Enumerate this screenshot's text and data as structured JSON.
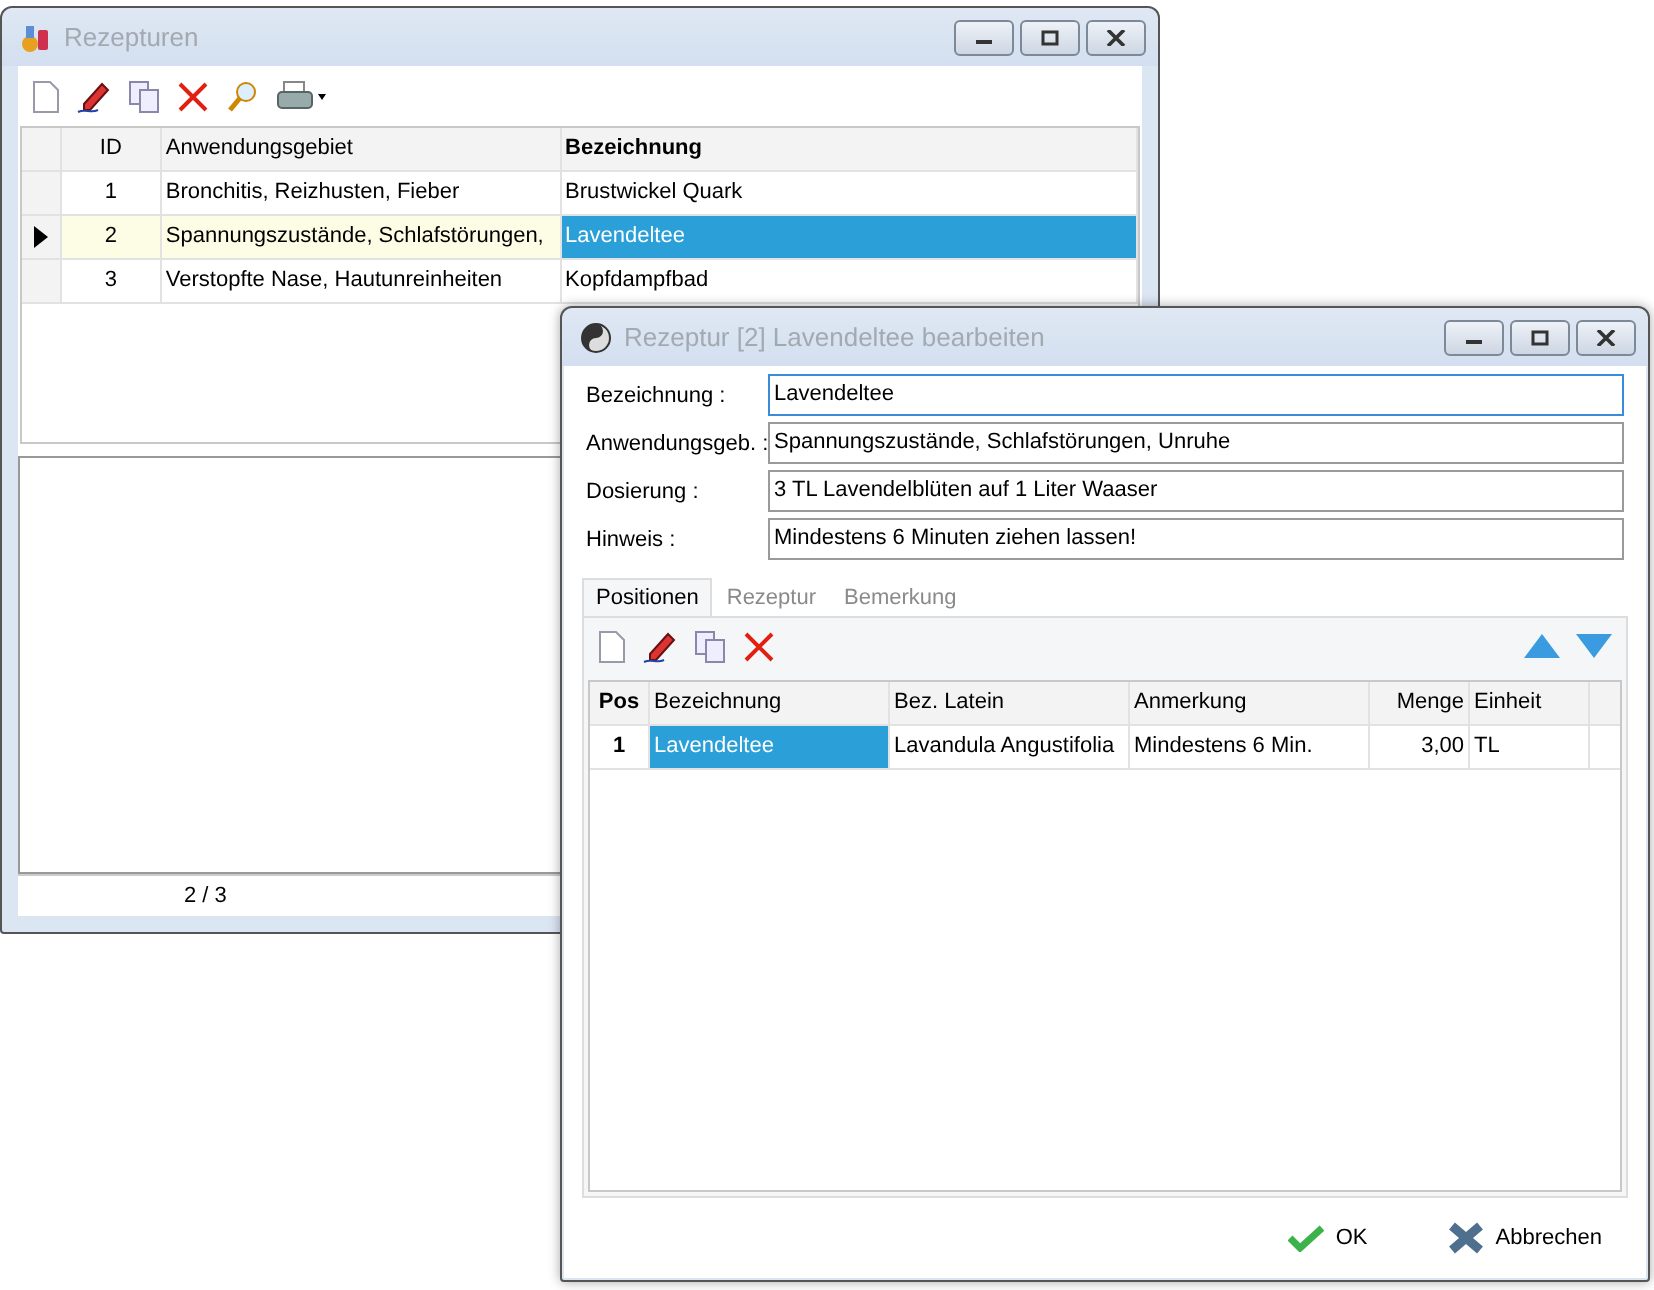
{
  "main_window": {
    "title": "Rezepturen",
    "table": {
      "columns": [
        {
          "label": "ID",
          "bold": false
        },
        {
          "label": "Anwendungsgebiet",
          "bold": false
        },
        {
          "label": "Bezeichnung",
          "bold": true
        }
      ],
      "rows": [
        {
          "cells": [
            "1",
            "Bronchitis, Reizhusten, Fieber",
            "Brustwickel Quark"
          ],
          "selected": false
        },
        {
          "cells": [
            "2",
            "Spannungszustände, Schlafstörungen,",
            "Lavendeltee"
          ],
          "selected": true
        },
        {
          "cells": [
            "3",
            "Verstopfte Nase, Hautunreinheiten",
            "Kopfdampfbad"
          ],
          "selected": false
        }
      ]
    },
    "status_bar": "2 / 3"
  },
  "dialog": {
    "title": "Rezeptur [2] Lavendeltee bearbeiten",
    "fields": [
      {
        "label": "Bezeichnung :",
        "value": "Lavendeltee",
        "focused": true
      },
      {
        "label": "Anwendungsgeb. :",
        "value": "Spannungszustände, Schlafstörungen, Unruhe",
        "focused": false
      },
      {
        "label": "Dosierung :",
        "value": "3 TL Lavendelblüten auf 1 Liter Waaser",
        "focused": false
      },
      {
        "label": "Hinweis :",
        "value": "Mindestens 6 Minuten ziehen lassen!",
        "focused": false
      }
    ],
    "tabs": [
      {
        "label": "Positionen",
        "selected": true
      },
      {
        "label": "Rezeptur",
        "selected": false
      },
      {
        "label": "Bemerkung",
        "selected": false
      }
    ],
    "table": {
      "columns": [
        {
          "label": "Pos",
          "bold": true
        },
        {
          "label": "Bezeichnung",
          "bold": false
        },
        {
          "label": "Bez. Latein",
          "bold": false
        },
        {
          "label": "Anmerkung",
          "bold": false
        },
        {
          "label": "Menge",
          "bold": false
        },
        {
          "label": "Einheit",
          "bold": false
        }
      ],
      "rows": [
        {
          "cells": [
            "1",
            "Lavendeltee",
            "Lavandula Angustifolia",
            "Mindestens 6 Min.",
            "3,00",
            "TL"
          ],
          "selected": true
        }
      ]
    },
    "buttons": [
      {
        "label": "OK",
        "kind": "ok"
      },
      {
        "label": "Abbrechen",
        "kind": "cancel"
      }
    ]
  }
}
